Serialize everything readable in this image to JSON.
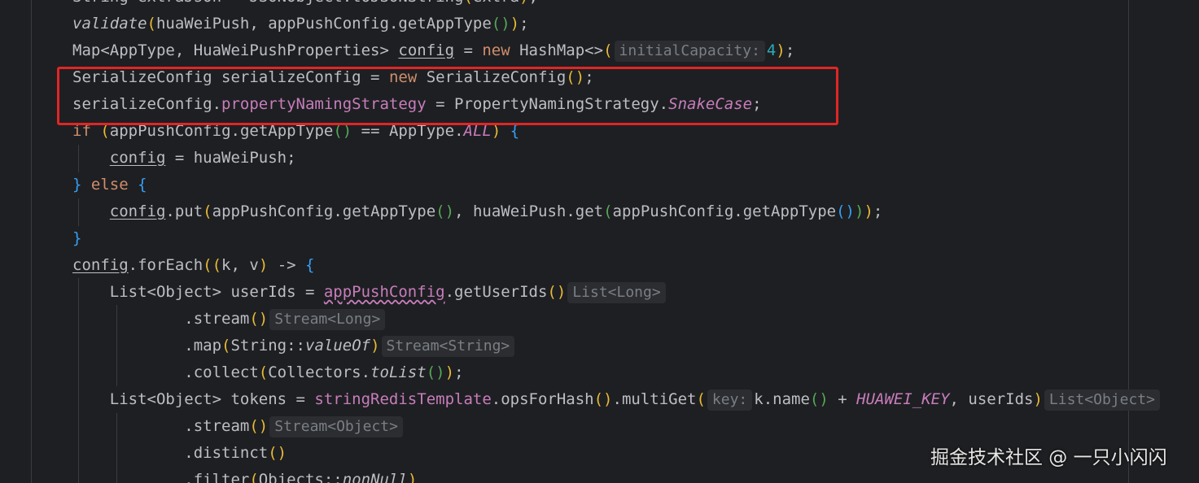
{
  "watermark": "掘金技术社区 @ 一只小闪闪",
  "lines": [
    [
      [
        "String extraJson = JSONObject.toJSONString",
        "plain"
      ],
      [
        "(",
        "paren1"
      ],
      [
        "extra",
        "plain"
      ],
      [
        ")",
        "paren1"
      ],
      [
        ";",
        "plain"
      ]
    ],
    [
      [
        "validate",
        "italfn"
      ],
      [
        "(",
        "paren1"
      ],
      [
        "huaWeiPush, appPushConfig.getAppType",
        "plain"
      ],
      [
        "()",
        "paren2"
      ],
      [
        ")",
        "paren1"
      ],
      [
        ";",
        "plain"
      ]
    ],
    [
      [
        "Map<AppType, HuaWeiPushProperties> ",
        "plain"
      ],
      [
        "config",
        "under"
      ],
      [
        " = ",
        "plain"
      ],
      [
        "new",
        "kw"
      ],
      [
        " HashMap<>",
        "plain"
      ],
      [
        "(",
        "paren1"
      ],
      [
        "initialCapacity:",
        "hint"
      ],
      [
        "4",
        "num"
      ],
      [
        ")",
        "paren1"
      ],
      [
        ";",
        "plain"
      ]
    ],
    [
      [
        "SerializeConfig serializeConfig = ",
        "plain"
      ],
      [
        "new",
        "kw"
      ],
      [
        " SerializeConfig",
        "plain"
      ],
      [
        "()",
        "paren1"
      ],
      [
        ";",
        "plain"
      ]
    ],
    [
      [
        "serializeConfig.",
        "plain"
      ],
      [
        "propertyNamingStrategy",
        "fld"
      ],
      [
        " = PropertyNamingStrategy.",
        "plain"
      ],
      [
        "SnakeCase",
        "const"
      ],
      [
        ";",
        "plain"
      ]
    ],
    [
      [
        "if",
        "kw"
      ],
      [
        " ",
        "plain"
      ],
      [
        "(",
        "paren1"
      ],
      [
        "appPushConfig.getAppType",
        "plain"
      ],
      [
        "()",
        "paren2"
      ],
      [
        " == AppType.",
        "plain"
      ],
      [
        "ALL",
        "const"
      ],
      [
        ")",
        "paren1"
      ],
      [
        " ",
        "plain"
      ],
      [
        "{",
        "paren3"
      ]
    ],
    [
      [
        "    ",
        "plain"
      ],
      [
        "config",
        "under"
      ],
      [
        " = huaWeiPush;",
        "plain"
      ]
    ],
    [
      [
        "}",
        "paren3"
      ],
      [
        " ",
        "plain"
      ],
      [
        "else",
        "kw"
      ],
      [
        " ",
        "plain"
      ],
      [
        "{",
        "paren3"
      ]
    ],
    [
      [
        "    ",
        "plain"
      ],
      [
        "config",
        "under"
      ],
      [
        ".put",
        "plain"
      ],
      [
        "(",
        "paren1"
      ],
      [
        "appPushConfig.getAppType",
        "plain"
      ],
      [
        "()",
        "paren2"
      ],
      [
        ", huaWeiPush.get",
        "plain"
      ],
      [
        "(",
        "paren2"
      ],
      [
        "appPushConfig.getAppType",
        "plain"
      ],
      [
        "()",
        "paren3"
      ],
      [
        ")",
        "paren2"
      ],
      [
        ")",
        "paren1"
      ],
      [
        ";",
        "plain"
      ]
    ],
    [
      [
        "}",
        "paren3"
      ]
    ],
    [
      [
        "config",
        "under"
      ],
      [
        ".forEach",
        "plain"
      ],
      [
        "((",
        "paren1"
      ],
      [
        "k, v",
        "plain"
      ],
      [
        ")",
        "paren1"
      ],
      [
        " -> ",
        "plain"
      ],
      [
        "{",
        "paren3"
      ]
    ],
    [
      [
        "    List<Object> userIds = ",
        "plain"
      ],
      [
        "appPushConfig",
        "wave"
      ],
      [
        ".getUserIds",
        "plain"
      ],
      [
        "()",
        "paren1"
      ],
      [
        "List<Long>",
        "hint"
      ]
    ],
    [
      [
        "            .stream",
        "plain"
      ],
      [
        "()",
        "paren1"
      ],
      [
        "Stream<Long>",
        "hint"
      ]
    ],
    [
      [
        "            .map",
        "plain"
      ],
      [
        "(",
        "paren1"
      ],
      [
        "String::",
        "plain"
      ],
      [
        "valueOf",
        "italfn"
      ],
      [
        ")",
        "paren1"
      ],
      [
        "Stream<String>",
        "hint"
      ]
    ],
    [
      [
        "            .collect",
        "plain"
      ],
      [
        "(",
        "paren1"
      ],
      [
        "Collectors.",
        "plain"
      ],
      [
        "toList",
        "italfn"
      ],
      [
        "()",
        "paren2"
      ],
      [
        ")",
        "paren1"
      ],
      [
        ";",
        "plain"
      ]
    ],
    [
      [
        "    List<Object> tokens = ",
        "plain"
      ],
      [
        "stringRedisTemplate",
        "fld"
      ],
      [
        ".opsForHash",
        "plain"
      ],
      [
        "()",
        "paren1"
      ],
      [
        ".multiGet",
        "plain"
      ],
      [
        "(",
        "paren1"
      ],
      [
        "key:",
        "hint"
      ],
      [
        "k.name",
        "plain"
      ],
      [
        "()",
        "paren2"
      ],
      [
        " + ",
        "plain"
      ],
      [
        "HUAWEI_KEY",
        "const"
      ],
      [
        ", userIds",
        "plain"
      ],
      [
        ")",
        "paren1"
      ],
      [
        "List<Object>",
        "hint"
      ]
    ],
    [
      [
        "            .stream",
        "plain"
      ],
      [
        "()",
        "paren1"
      ],
      [
        "Stream<Object>",
        "hint"
      ]
    ],
    [
      [
        "            .distinct",
        "plain"
      ],
      [
        "()",
        "paren1"
      ]
    ],
    [
      [
        "            .filter",
        "plain"
      ],
      [
        "(",
        "paren1"
      ],
      [
        "Objects::",
        "plain"
      ],
      [
        "nonNull",
        "italfn"
      ],
      [
        ")",
        "paren1"
      ]
    ]
  ]
}
